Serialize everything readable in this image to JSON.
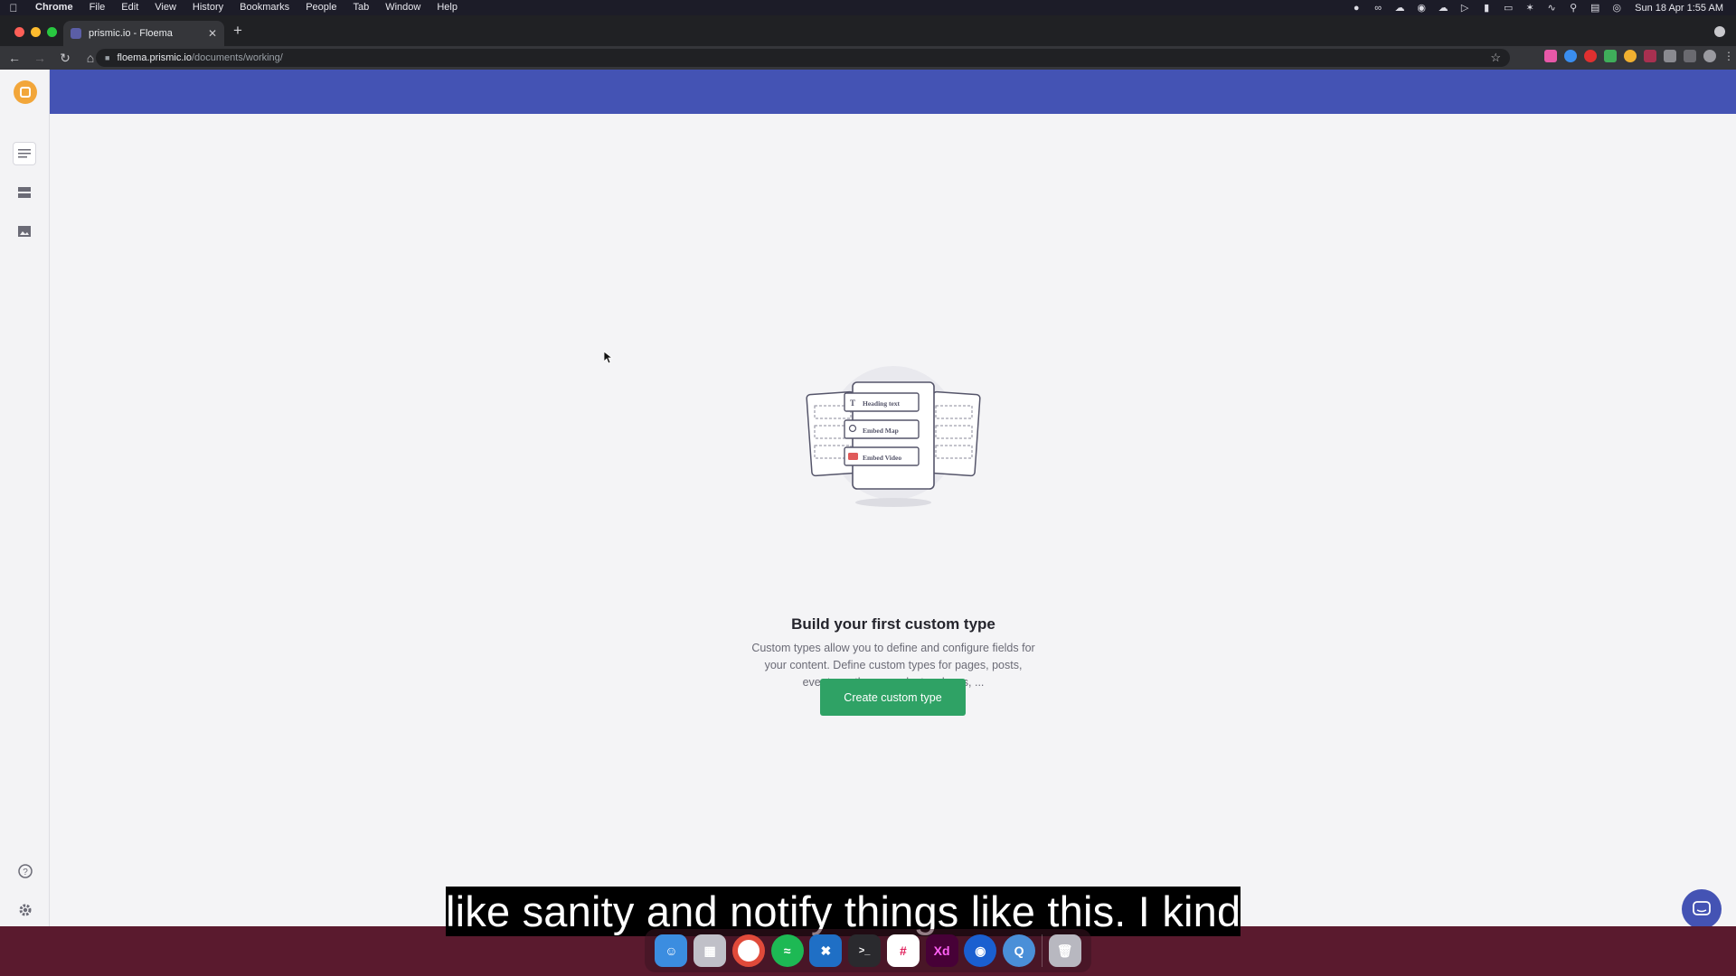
{
  "menubar": {
    "app": "Chrome",
    "items": [
      "File",
      "Edit",
      "View",
      "History",
      "Bookmarks",
      "People",
      "Tab",
      "Window",
      "Help"
    ],
    "clock": "Sun 18 Apr  1:55 AM"
  },
  "browser": {
    "tab_title": "prismic.io - Floema",
    "url_host": "floema.prismic.io",
    "url_path": "/documents/working/"
  },
  "illustration": {
    "fields": [
      "Heading text",
      "Embed Map",
      "Embed Video"
    ]
  },
  "empty_state": {
    "title": "Build your first custom type",
    "description": "Custom types allow you to define and configure fields for your content. Define custom types for pages, posts, events, authors, products, places, ...",
    "cta_label": "Create custom type"
  },
  "subtitle": "like sanity and notify things like this. I kind",
  "colors": {
    "topbar": "#4453b4",
    "cta": "#2fa265",
    "logo": "#f2a63a"
  },
  "dock": {
    "apps": [
      "finder-icon",
      "launchpad-icon",
      "chrome-icon",
      "spotify-icon",
      "vscode-icon",
      "terminal-icon",
      "slack-icon",
      "xd-icon",
      "maps-icon",
      "quicktime-icon",
      "trash-icon"
    ],
    "xd_label": "Xd"
  }
}
